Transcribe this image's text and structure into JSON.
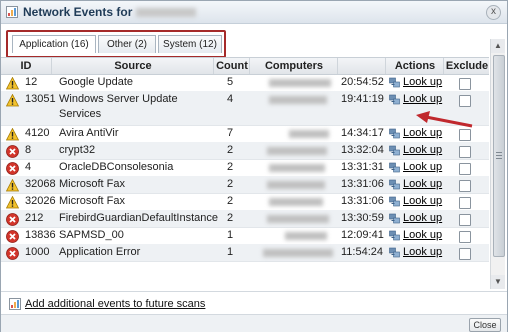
{
  "window": {
    "title": "Network Events for",
    "close_label": "x"
  },
  "tabs": [
    {
      "label": "Application (16)",
      "active": true
    },
    {
      "label": "Other (2)",
      "active": false
    },
    {
      "label": "System (12)",
      "active": false
    }
  ],
  "table": {
    "headers": [
      "ID",
      "Source",
      "Count",
      "Computers",
      "",
      "Actions",
      "Exclude"
    ],
    "rows": [
      {
        "icon": "warning-icon",
        "id": "12",
        "source": "Google Update",
        "count": "5",
        "time": "20:54:52",
        "action": "Look up"
      },
      {
        "icon": "warning-icon",
        "id": "13051",
        "source": "Windows Server Update",
        "source2": "Services",
        "count": "4",
        "time": "19:41:19",
        "action": "Look up"
      },
      {
        "icon": "warning-icon",
        "id": "4120",
        "source": "Avira AntiVir",
        "count": "7",
        "time": "14:34:17",
        "action": "Look up"
      },
      {
        "icon": "error-icon",
        "id": "8",
        "source": "crypt32",
        "count": "2",
        "time": "13:32:04",
        "action": "Look up"
      },
      {
        "icon": "error-icon",
        "id": "4",
        "source": "OracleDBConsolesonia",
        "count": "2",
        "time": "13:31:31",
        "action": "Look up"
      },
      {
        "icon": "warning-icon",
        "id": "32068",
        "source": "Microsoft Fax",
        "count": "2",
        "time": "13:31:06",
        "action": "Look up"
      },
      {
        "icon": "warning-icon",
        "id": "32026",
        "source": "Microsoft Fax",
        "count": "2",
        "time": "13:31:06",
        "action": "Look up"
      },
      {
        "icon": "error-icon",
        "id": "212",
        "source": "FirebirdGuardianDefaultInstance",
        "count": "2",
        "time": "13:30:59",
        "action": "Look up"
      },
      {
        "icon": "error-icon",
        "id": "13836",
        "source": "SAPMSD_00",
        "count": "1",
        "time": "12:09:41",
        "action": "Look up"
      },
      {
        "icon": "error-icon",
        "id": "1000",
        "source": "Application Error",
        "count": "1",
        "time": "11:54:24",
        "action": "Look up"
      }
    ]
  },
  "footer": {
    "add_events_label": "Add additional events to future scans",
    "close_button": "Close"
  },
  "colors": {
    "highlight_border": "#a52a2a",
    "arrow": "#c0282d",
    "warning": "#f2c22e",
    "error": "#d2352b"
  }
}
